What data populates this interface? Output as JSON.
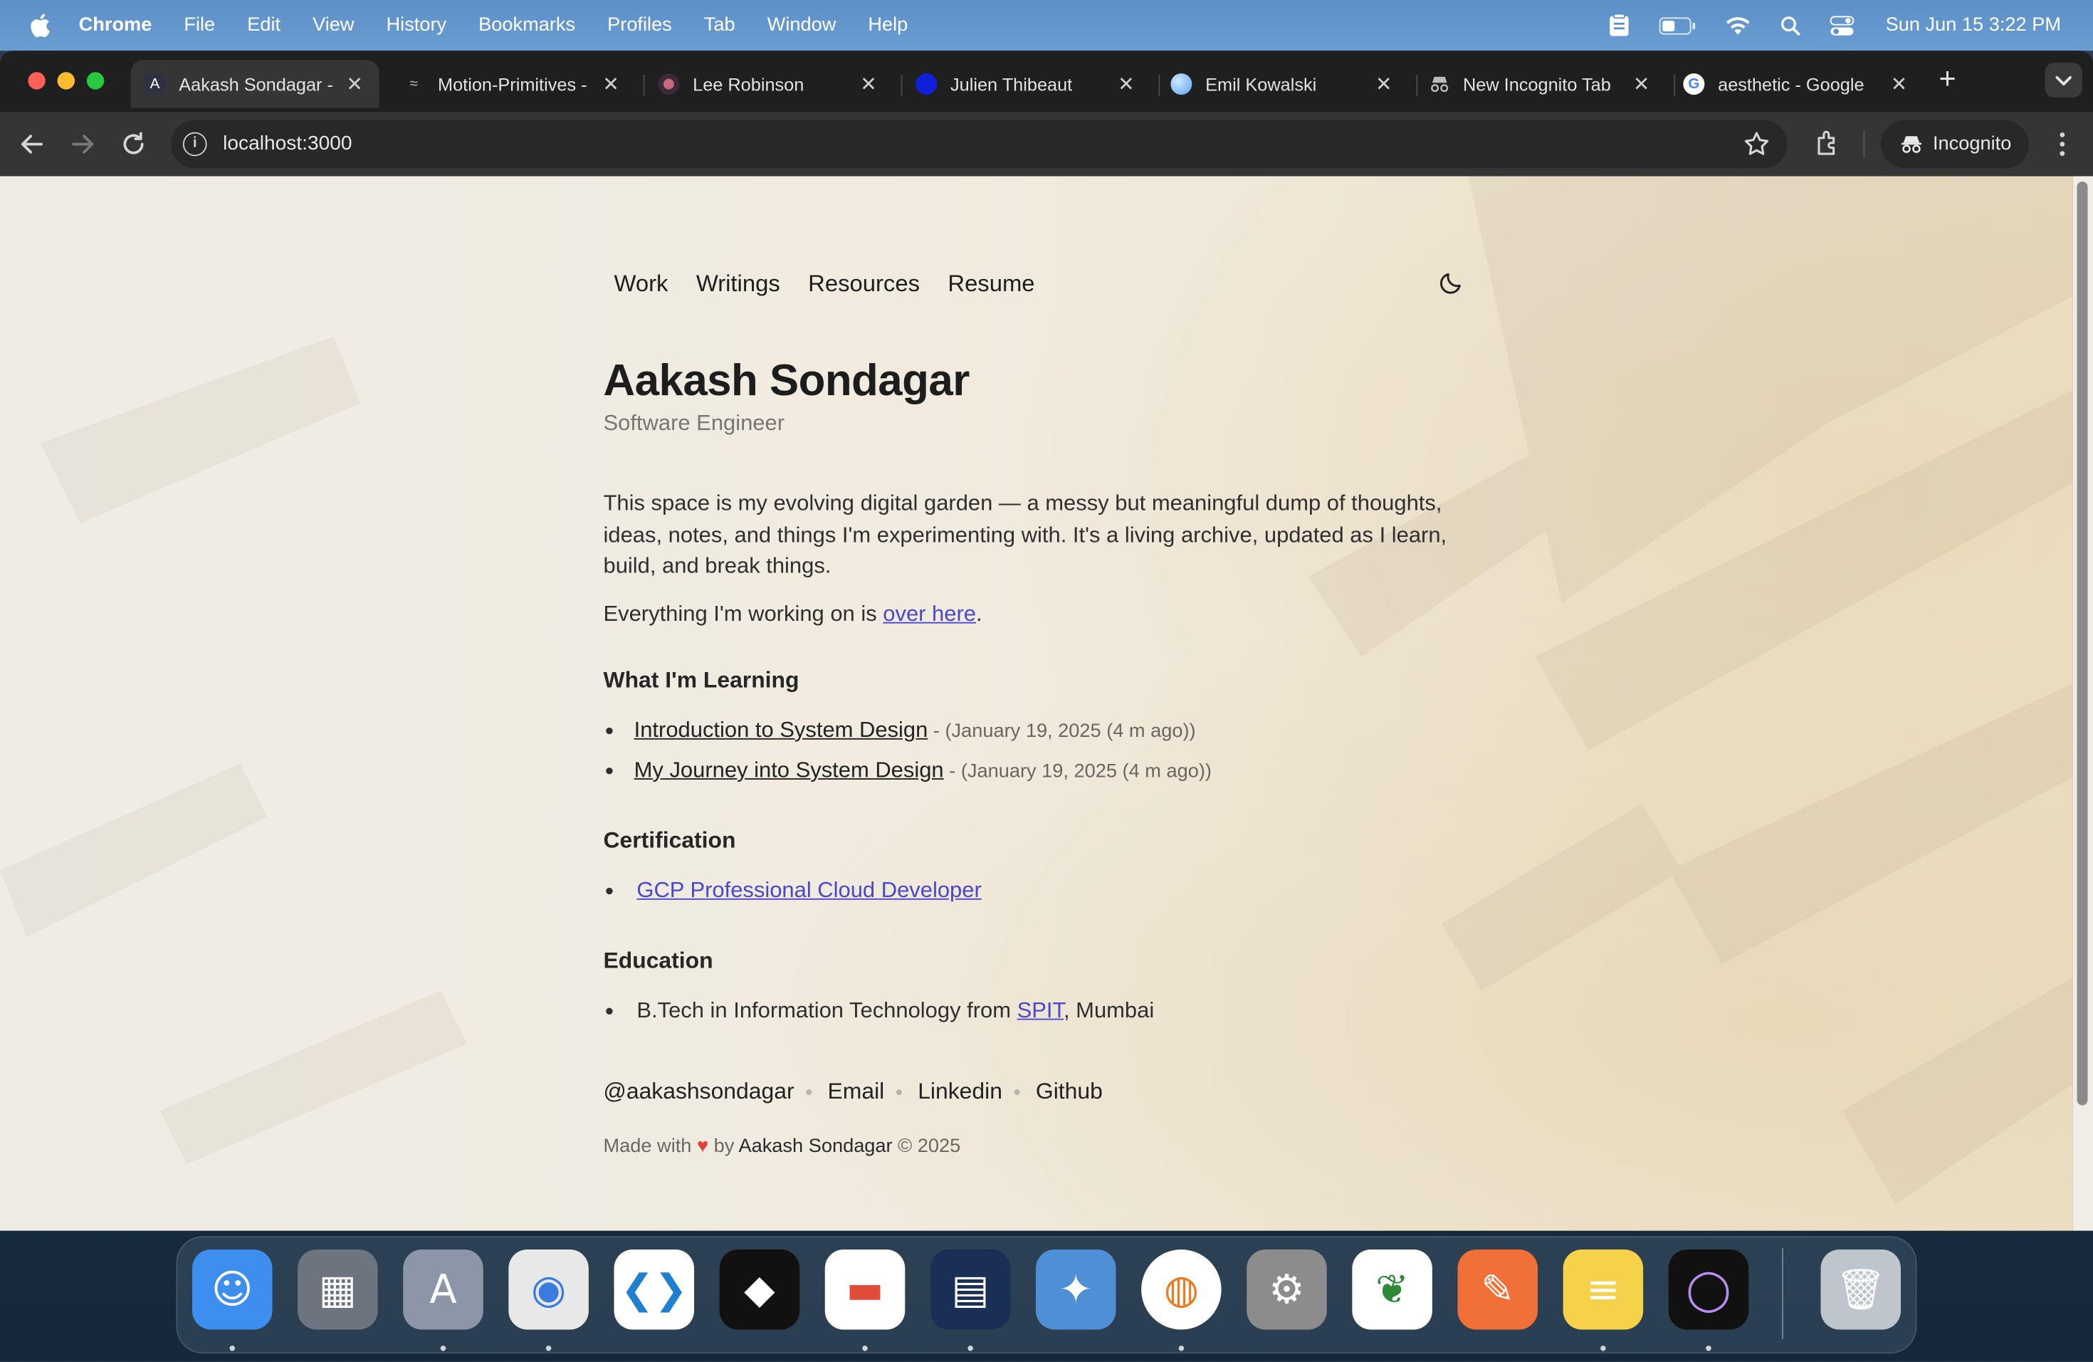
{
  "menubar": {
    "app": "Chrome",
    "items": [
      "File",
      "Edit",
      "View",
      "History",
      "Bookmarks",
      "Profiles",
      "Tab",
      "Window",
      "Help"
    ],
    "clock": "Sun Jun 15  3:22 PM"
  },
  "tabs": [
    {
      "title": "Aakash Sondagar - ",
      "active": true,
      "favicon": "a-logo-icon"
    },
    {
      "title": "Motion-Primitives - ",
      "active": false,
      "favicon": "motion-icon"
    },
    {
      "title": "Lee Robinson",
      "active": false,
      "favicon": "avatar-icon"
    },
    {
      "title": "Julien Thibeaut",
      "active": false,
      "favicon": "blue-dot-icon"
    },
    {
      "title": "Emil Kowalski",
      "active": false,
      "favicon": "sphere-icon"
    },
    {
      "title": "New Incognito Tab",
      "active": false,
      "favicon": "incognito-icon"
    },
    {
      "title": "aesthetic - Google ",
      "active": false,
      "favicon": "google-icon"
    }
  ],
  "toolbar": {
    "url": "localhost:3000",
    "incognito_label": "Incognito"
  },
  "site": {
    "nav": [
      "Work",
      "Writings",
      "Resources",
      "Resume"
    ],
    "name": "Aakash Sondagar",
    "role": "Software Engineer",
    "intro": "This space is my evolving digital garden — a messy but meaningful dump of thoughts, ideas, notes, and things I'm experimenting with. It's a living archive, updated as I learn, build, and break things.",
    "working_prefix": "Everything I'm working on is ",
    "working_link": "over here",
    "working_suffix": ".",
    "learning_title": "What I'm Learning",
    "learning": [
      {
        "title": "Introduction to System Design",
        "date": " - (January 19, 2025 (4 m ago))"
      },
      {
        "title": "My Journey into System Design",
        "date": " - (January 19, 2025 (4 m ago))"
      }
    ],
    "cert_title": "Certification",
    "certs": [
      "GCP Professional Cloud Developer"
    ],
    "edu_title": "Education",
    "edu_prefix": "B.Tech in Information Technology from ",
    "edu_link": "SPIT",
    "edu_suffix": ", Mumbai",
    "socials": [
      "@aakashsondagar",
      "Email",
      "Linkedin",
      "Github"
    ],
    "footer_prefix": "Made with ",
    "footer_heart": "♥",
    "footer_by": " by ",
    "footer_name": "Aakash Sondagar",
    "footer_suffix": " © 2025"
  },
  "dock": [
    {
      "name": "finder-icon",
      "color": "#3e8ef0"
    },
    {
      "name": "launchpad-icon",
      "color": "#6c7480"
    },
    {
      "name": "arc-icon",
      "color": "#8d95a8"
    },
    {
      "name": "chrome-icon",
      "color": "#e8e8e8"
    },
    {
      "name": "vscode-icon",
      "color": "#ffffff"
    },
    {
      "name": "cube-app-icon",
      "color": "#111111"
    },
    {
      "name": "speakerdeck-icon",
      "color": "#ffffff"
    },
    {
      "name": "notes-stack-icon",
      "color": "#1a2f55"
    },
    {
      "name": "screenshot-icon",
      "color": "#4f8fd6"
    },
    {
      "name": "openvpn-icon",
      "color": "#ffffff"
    },
    {
      "name": "system-settings-icon",
      "color": "#8c8c8c"
    },
    {
      "name": "mongodb-icon",
      "color": "#ffffff"
    },
    {
      "name": "postman-icon",
      "color": "#f07038"
    },
    {
      "name": "notes-icon",
      "color": "#f5d24a"
    },
    {
      "name": "raycast-ring-icon",
      "color": "#111111"
    },
    {
      "name": "trash-icon",
      "color": "#bfc5cc"
    }
  ]
}
